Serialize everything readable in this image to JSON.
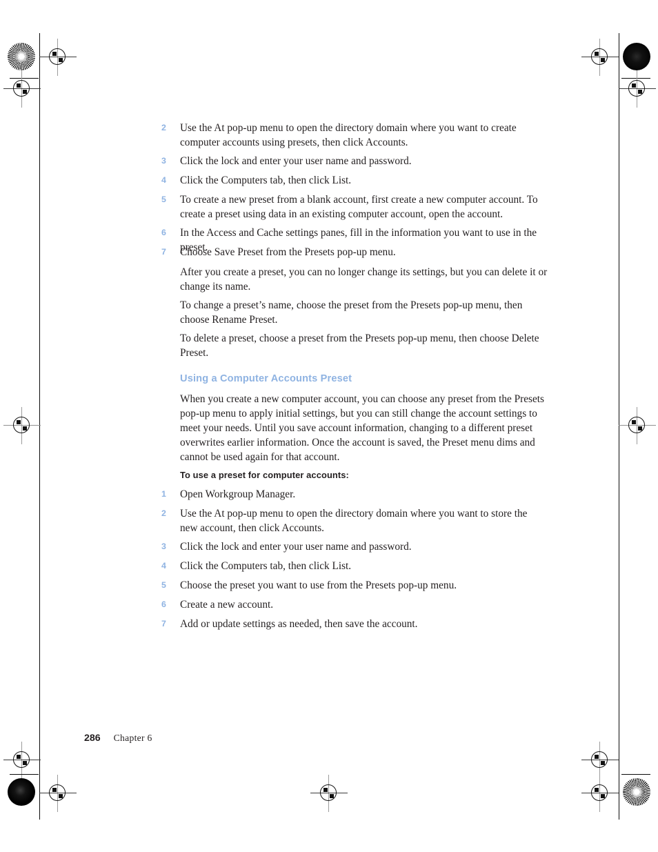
{
  "page": {
    "number": "286",
    "chapter_label": "Chapter  6"
  },
  "steps_top": [
    {
      "num": "2",
      "text": "Use the At pop-up menu to open the directory domain where you want to create computer accounts using presets, then click Accounts."
    },
    {
      "num": "3",
      "text": "Click the lock and enter your user name and password."
    },
    {
      "num": "4",
      "text": "Click the Computers tab, then click List."
    },
    {
      "num": "5",
      "text": "To create a new preset from a blank account, first create a new computer account. To create a preset using data in an existing computer account, open the account."
    },
    {
      "num": "6",
      "text": "In the Access and Cache settings panes, fill in the information you want to use in the preset."
    },
    {
      "num": "7",
      "text": "Choose Save Preset from the Presets pop-up menu."
    }
  ],
  "notes": [
    "After you create a preset, you can no longer change its settings, but you can delete it or change its name.",
    "To change a preset’s name, choose the preset from the Presets pop-up menu, then choose Rename Preset.",
    "To delete a preset, choose a preset from the Presets pop-up menu, then choose Delete Preset."
  ],
  "section": {
    "heading": "Using a Computer Accounts Preset",
    "intro": "When you create a new computer account, you can choose any preset from the Presets pop-up menu to apply initial settings, but you can still change the account settings to meet your needs. Until you save account information, changing to a different preset overwrites earlier information. Once the account is saved, the Preset menu dims and cannot be used again for that account."
  },
  "task": {
    "heading": "To use a preset for computer accounts:",
    "steps": [
      {
        "num": "1",
        "text": "Open Workgroup Manager."
      },
      {
        "num": "2",
        "text": "Use the At pop-up menu to open the directory domain where you want to store the new account, then click Accounts."
      },
      {
        "num": "3",
        "text": "Click the lock and enter your user name and password."
      },
      {
        "num": "4",
        "text": "Click the Computers tab, then click List."
      },
      {
        "num": "5",
        "text": "Choose the preset you want to use from the Presets pop-up menu."
      },
      {
        "num": "6",
        "text": "Create a new account."
      },
      {
        "num": "7",
        "text": "Add or update settings as needed, then save the account."
      }
    ]
  },
  "colors": {
    "accent_blue": "#8fb3e2",
    "body_text": "#231f20",
    "paper": "#ffffff"
  },
  "print_marks": {
    "label": "registration-and-trim-marks"
  }
}
